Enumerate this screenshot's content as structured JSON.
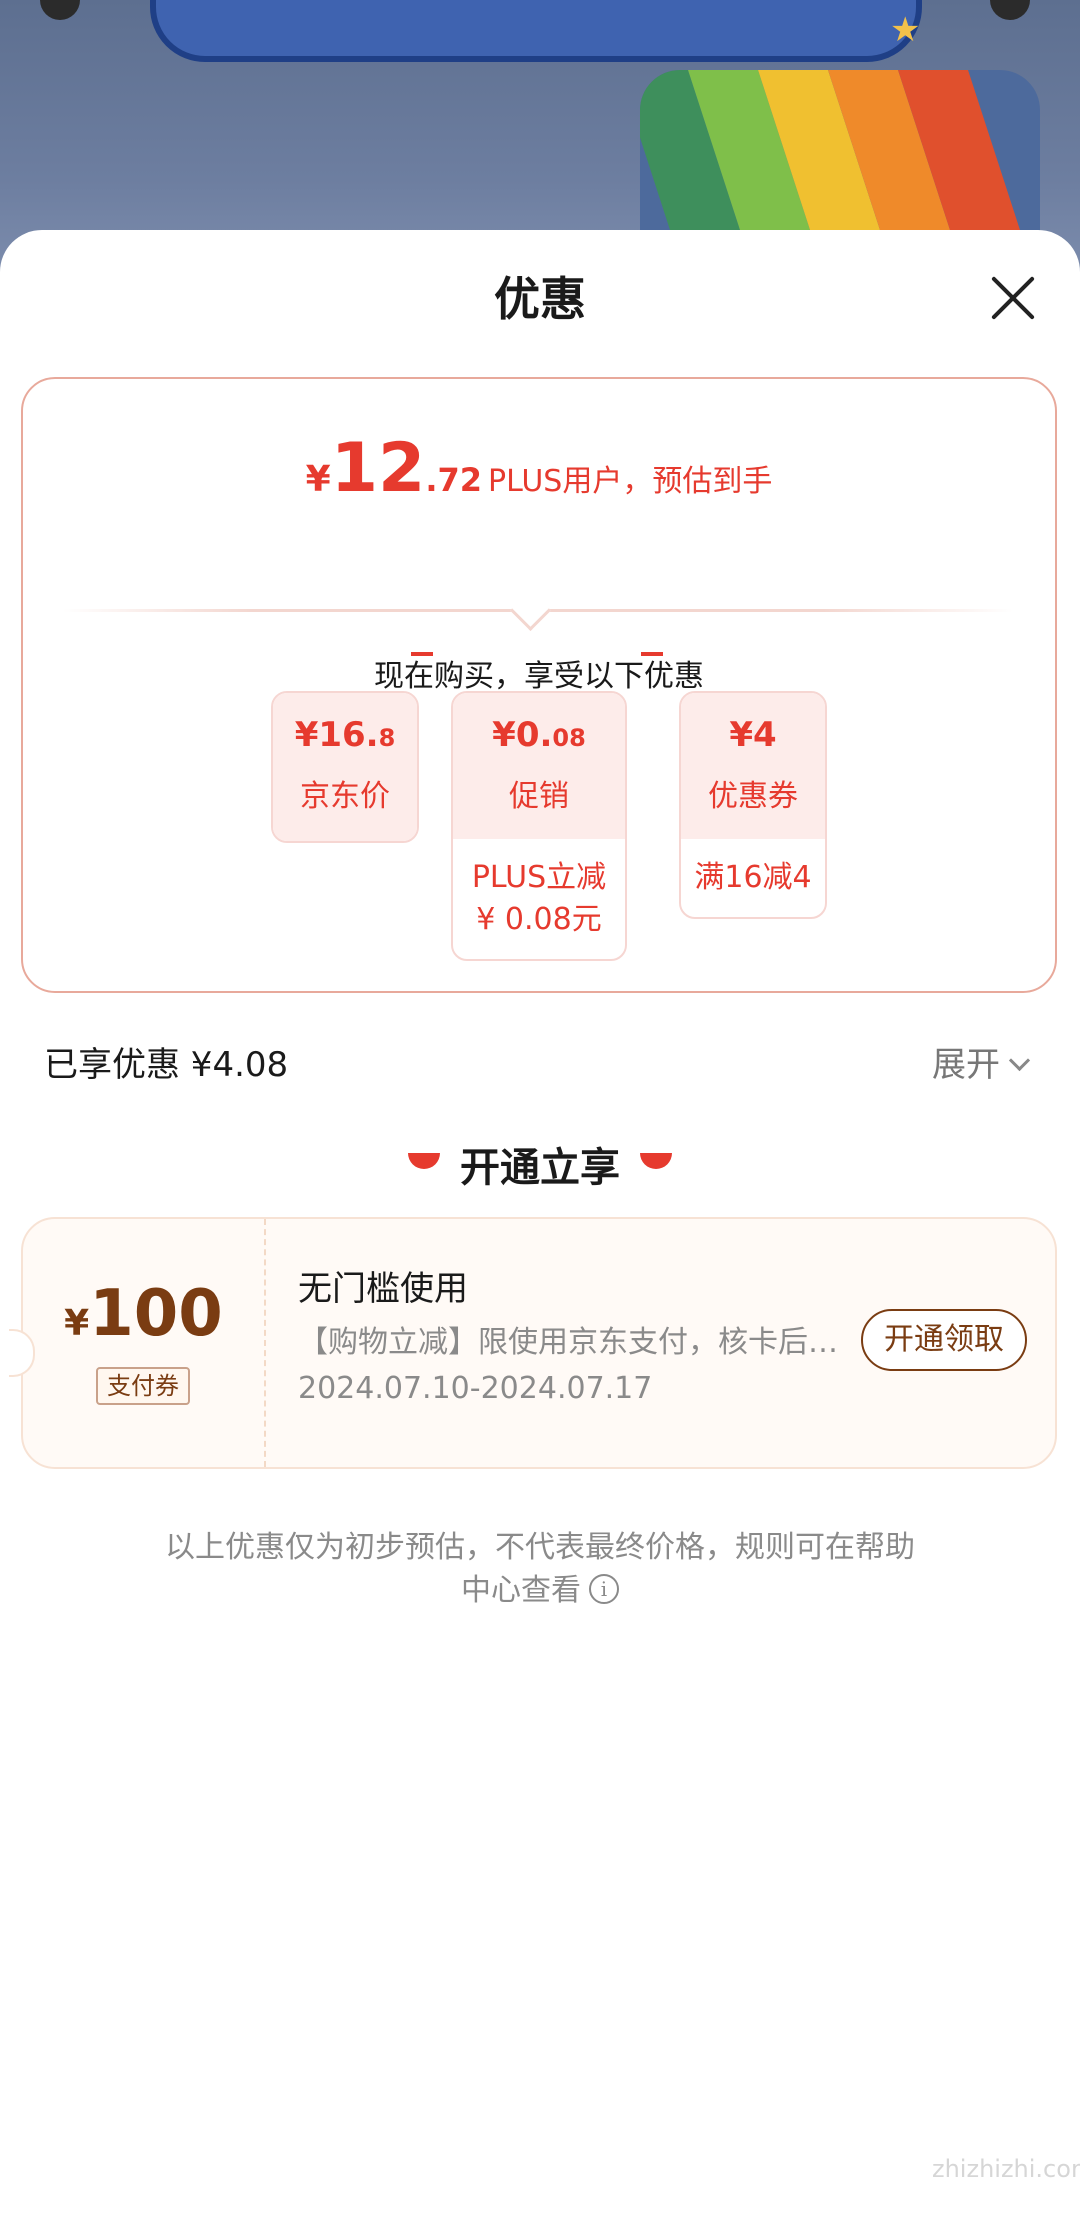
{
  "header": {
    "title": "优惠",
    "close_label": "关闭"
  },
  "price": {
    "currency": "¥",
    "integer": "12",
    "decimal": ".72",
    "note": "PLUS用户，预估到手"
  },
  "breakdown": {
    "subtitle": "现在购买，享受以下优惠",
    "items": [
      {
        "amount_main": "¥16.",
        "amount_small": "8",
        "label": "京东价",
        "detail": ""
      },
      {
        "amount_main": "¥0.",
        "amount_small": "08",
        "label": "促销",
        "detail_line1": "PLUS立减",
        "detail_line2": "¥ 0.08元"
      },
      {
        "amount_main": "¥4",
        "amount_small": "",
        "label": "优惠券",
        "detail_line1": "满16减4"
      }
    ]
  },
  "summary": {
    "saved": "已享优惠 ¥4.08",
    "expand": "展开"
  },
  "open_section": {
    "title": "开通立享"
  },
  "coupon": {
    "currency": "¥",
    "value": "100",
    "tag": "支付券",
    "title": "无门槛使用",
    "desc": "【购物立减】限使用京东支付，核卡后领取使用",
    "dates": "2024.07.10-2024.07.17",
    "button": "开通领取"
  },
  "footnote": {
    "line1": "以上优惠仅为初步预估，不代表最终价格，规则可在帮助",
    "line2": "中心查看",
    "icon": "i"
  },
  "watermark": "zhizhizhi.com",
  "colors": {
    "accent_red": "#e63a2e",
    "coupon_brown": "#7a3c12"
  }
}
